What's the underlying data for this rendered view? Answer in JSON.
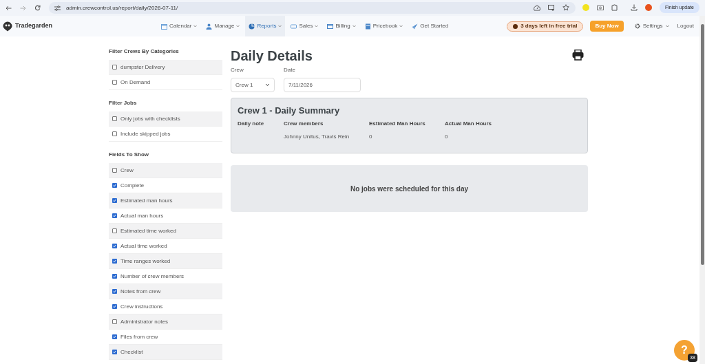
{
  "browser": {
    "url": "admin.crewcontrol.us/report/daily/2026-07-11/",
    "update_button": "Finish update"
  },
  "nav": {
    "brand": "Tradegarden",
    "items": [
      {
        "label": "Calendar",
        "selected": false,
        "dropdown": true
      },
      {
        "label": "Manage",
        "selected": false,
        "dropdown": true
      },
      {
        "label": "Reports",
        "selected": true,
        "dropdown": true
      },
      {
        "label": "Sales",
        "selected": false,
        "dropdown": true
      },
      {
        "label": "Billing",
        "selected": false,
        "dropdown": true
      },
      {
        "label": "Pricebook",
        "selected": false,
        "dropdown": true
      },
      {
        "label": "Get Started",
        "selected": false,
        "dropdown": false
      }
    ],
    "trial": "3 days left in free trial",
    "buy": "Buy Now",
    "settings": "Settings",
    "logout": "Logout"
  },
  "sidebar": [
    {
      "title": "Filter Crews By Categories",
      "options": [
        {
          "label": "dumpster Delivery",
          "checked": false
        },
        {
          "label": "On Demand",
          "checked": false
        }
      ]
    },
    {
      "title": "Filter Jobs",
      "options": [
        {
          "label": "Only jobs with checklists",
          "checked": false
        },
        {
          "label": "Include skipped jobs",
          "checked": false
        }
      ]
    },
    {
      "title": "Fields To Show",
      "options": [
        {
          "label": "Crew",
          "checked": false
        },
        {
          "label": "Complete",
          "checked": true
        },
        {
          "label": "Estimated man hours",
          "checked": true
        },
        {
          "label": "Actual man hours",
          "checked": true
        },
        {
          "label": "Estimated time worked",
          "checked": false
        },
        {
          "label": "Actual time worked",
          "checked": true
        },
        {
          "label": "Time ranges worked",
          "checked": true
        },
        {
          "label": "Number of crew members",
          "checked": true
        },
        {
          "label": "Notes from crew",
          "checked": true
        },
        {
          "label": "Crew instructions",
          "checked": true
        },
        {
          "label": "Administrator notes",
          "checked": false
        },
        {
          "label": "Files from crew",
          "checked": true
        },
        {
          "label": "Checklist",
          "checked": true
        }
      ]
    }
  ],
  "main": {
    "title": "Daily Details",
    "crew_label": "Crew",
    "crew_value": "Crew 1",
    "date_label": "Date",
    "date_value": "7/11/2026",
    "summary": {
      "title": "Crew 1 - Daily Summary",
      "columns": [
        {
          "header": "Daily note"
        },
        {
          "header": "Crew members",
          "value": "Johnny Unitus, Travis Rein"
        },
        {
          "header": "Estimated Man Hours",
          "value": "0"
        },
        {
          "header": "Actual Man Hours",
          "value": "0"
        }
      ]
    },
    "empty": "No jobs were scheduled for this day"
  },
  "help": {
    "label": "?",
    "badge": "38"
  }
}
